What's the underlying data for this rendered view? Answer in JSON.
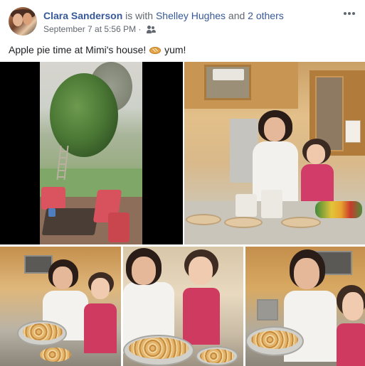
{
  "post": {
    "author": "Clara Sanderson",
    "with_text": "is with",
    "tagged_person": "Shelley Hughes",
    "and_text": "and",
    "others_text": "2 others",
    "timestamp": "September 7 at 5:56 PM",
    "separator": "·",
    "audience_icon": "friends-icon",
    "more_icon": "more-options-icon",
    "message_before": "Apple pie time at Mimi's house!",
    "message_emoji": "pie-emoji",
    "message_after": "yum!"
  },
  "photos": [
    {
      "kind": "video-frame",
      "subject": "backyard apple tree"
    },
    {
      "kind": "photo",
      "subject": "kitchen wide shot"
    },
    {
      "kind": "photo",
      "subject": "woman and girl with apples"
    },
    {
      "kind": "photo",
      "subject": "woman and girl peeling apples"
    },
    {
      "kind": "photo",
      "subject": "woman stirring apples"
    }
  ],
  "colors": {
    "link": "#365899",
    "secondary_text": "#616770",
    "primary_text": "#1c1e21",
    "background": "#ffffff"
  }
}
